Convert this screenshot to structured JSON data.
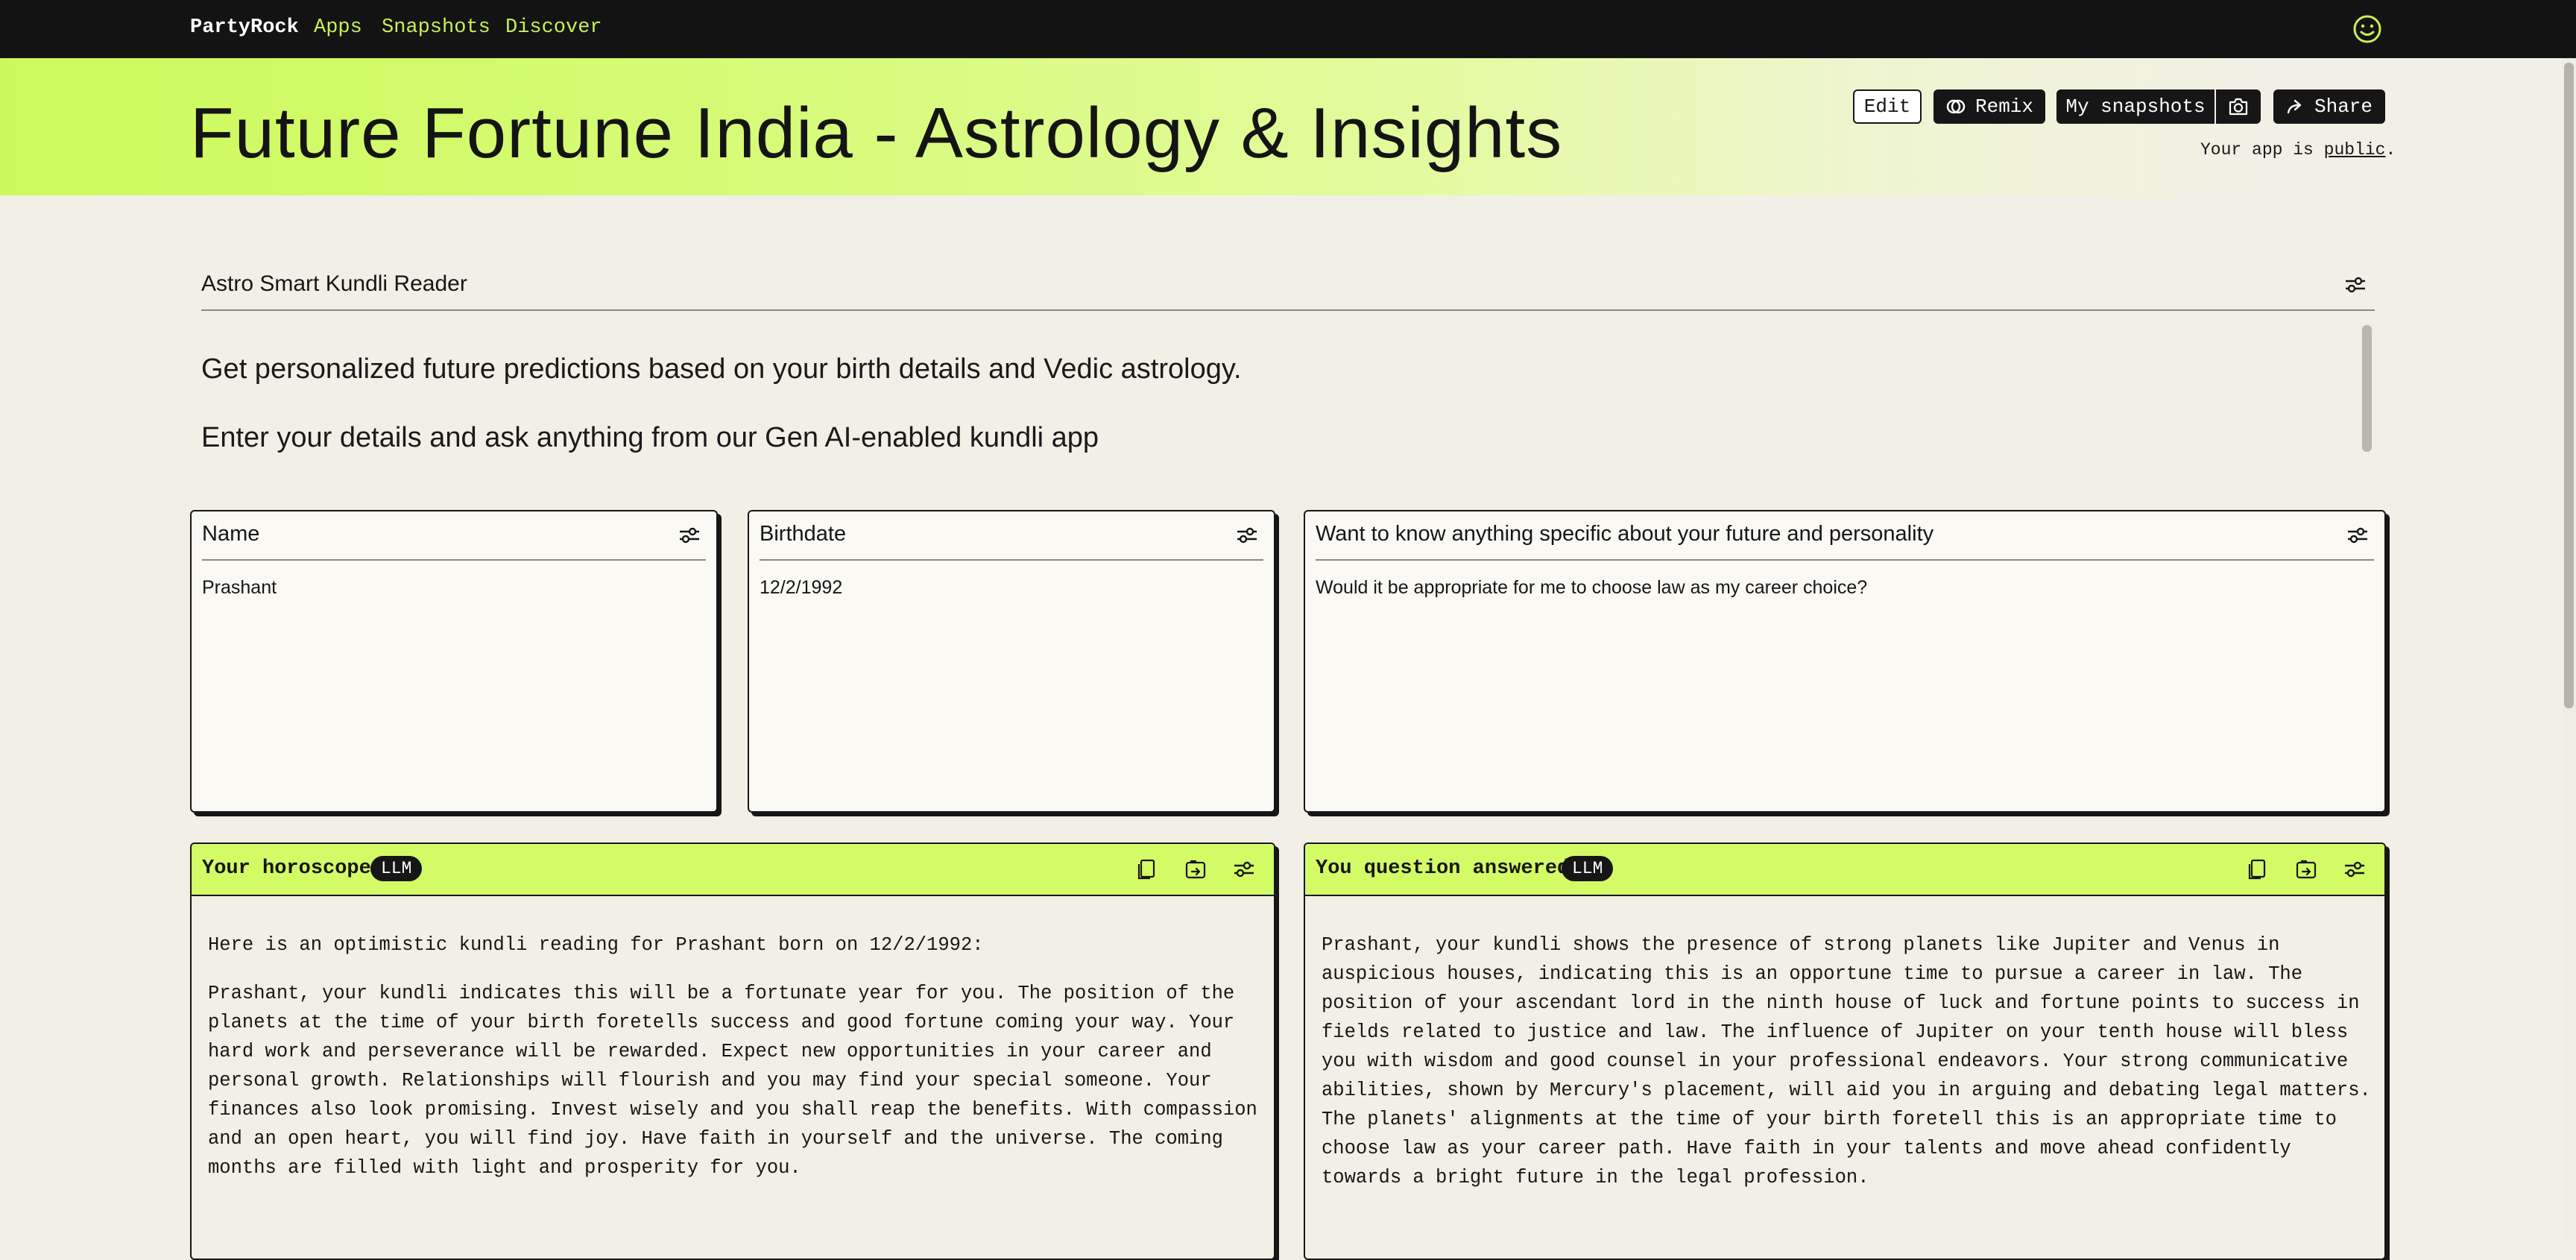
{
  "nav": {
    "brand": "PartyRock",
    "links": [
      "Apps",
      "Snapshots",
      "Discover"
    ],
    "avatar_icon": "smiley-face-icon",
    "accent_color": "#c8ee5a"
  },
  "header": {
    "title": "Future Fortune India - Astrology & Insights",
    "buttons": {
      "edit": "Edit",
      "remix": "Remix",
      "my_snapshots": "My snapshots",
      "share": "Share"
    },
    "public_note_prefix": "Your app is ",
    "public_note_link": "public",
    "public_note_suffix": "."
  },
  "reader": {
    "title": "Astro Smart Kundli Reader",
    "intro_line_1": "Get personalized future predictions based on your birth details and Vedic astrology.",
    "intro_line_2": "Enter your details and ask anything from our Gen AI-enabled kundli app"
  },
  "inputs": [
    {
      "title": "Name",
      "value": "Prashant"
    },
    {
      "title": "Birthdate",
      "value": "12/2/1992"
    },
    {
      "title": "Want to know anything specific about your future and personality",
      "value": "Would it be appropriate for me to choose law as my career choice?"
    }
  ],
  "outputs": [
    {
      "title": "Your horoscope",
      "badge": "LLM",
      "paragraphs": [
        "Here is an optimistic kundli reading for Prashant born on 12/2/1992:",
        "Prashant, your kundli indicates this will be a fortunate year for you. The position of the planets at the time of your birth foretells success and good fortune coming your way. Your hard work and perseverance will be rewarded. Expect new opportunities in your career and personal growth. Relationships will flourish and you may find your special someone. Your finances also look promising. Invest wisely and you shall reap the benefits. With compassion and an open heart, you will find joy. Have faith in yourself and the universe. The coming months are filled with light and prosperity for you."
      ]
    },
    {
      "title": "You question answered",
      "badge": "LLM",
      "paragraphs": [
        "Prashant, your kundli shows the presence of strong planets like Jupiter and Venus in auspicious houses, indicating this is an opportune time to pursue a career in law. The position of your ascendant lord in the ninth house of luck and fortune points to success in fields related to justice and law. The influence of Jupiter on your tenth house will bless you with wisdom and good counsel in your professional endeavors. Your strong communicative abilities, shown by Mercury's placement, will aid you in arguing and debating legal matters. The planets' alignments at the time of your birth foretell this is an appropriate time to choose law as your career path. Have faith in your talents and move ahead confidently towards a bright future in the legal profession."
      ]
    }
  ],
  "colors": {
    "nav_bg": "#131313",
    "banner_green": "#cdfa5b",
    "output_header": "#d3fb66",
    "page_bg": "#f2f0e6",
    "card_bg": "#faf9f3"
  }
}
